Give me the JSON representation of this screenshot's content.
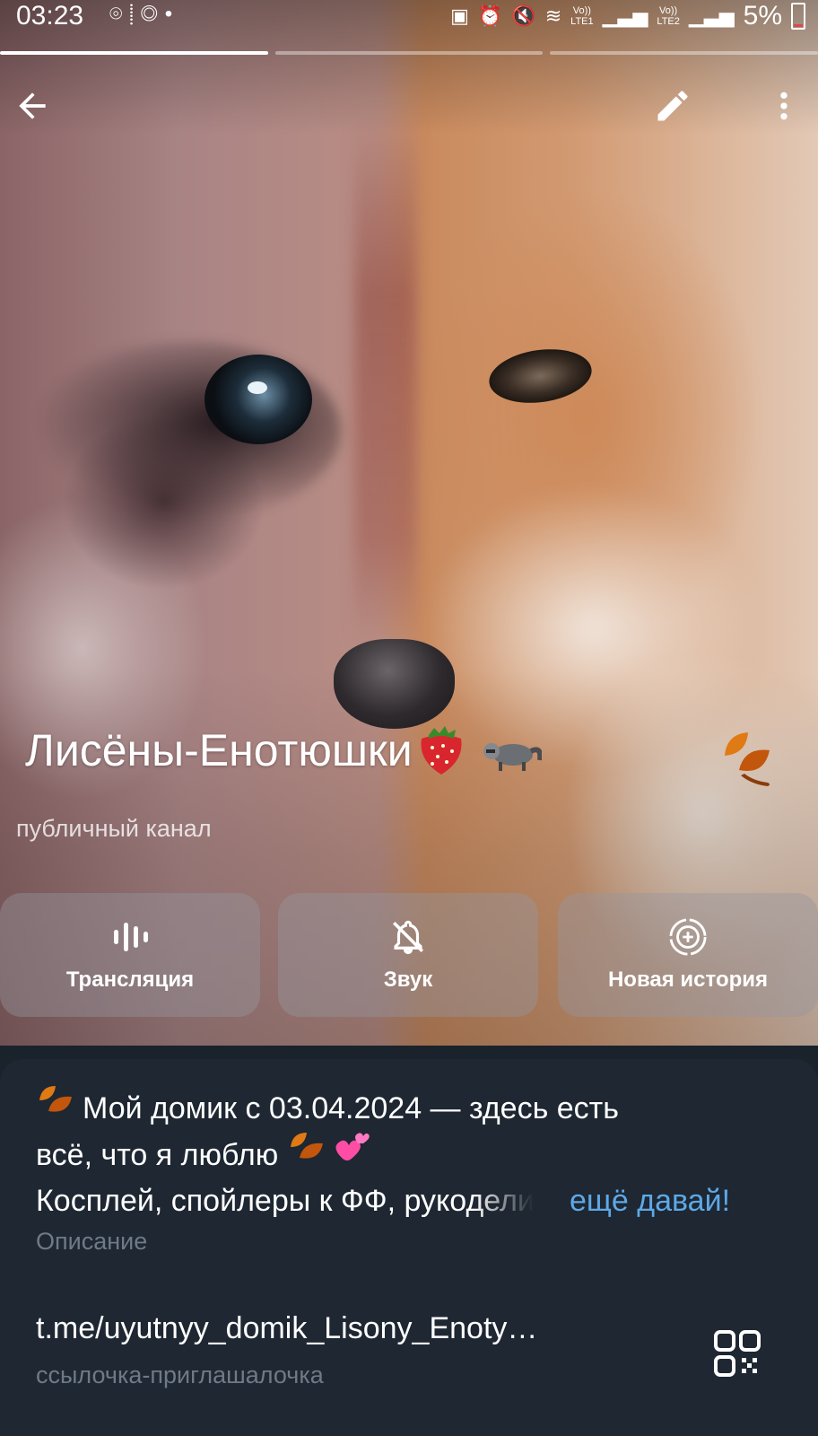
{
  "status_bar": {
    "time": "03:23",
    "left_icons": [
      "tracking-icon",
      "steps-icon",
      "nfc-icon",
      "dot-icon"
    ],
    "sim1": "LTE1",
    "sim2": "LTE2",
    "volte": "Vo))",
    "battery_percent": "5%"
  },
  "story_progress": {
    "segments": 3,
    "active_index": 0
  },
  "toolbar": {
    "back_icon": "arrow-left-icon",
    "edit_icon": "pencil-icon",
    "more_icon": "more-vertical-icon"
  },
  "channel": {
    "title_prefix": "’",
    "title": "Лисёны-Енотюшки",
    "title_emojis": [
      "🍓",
      "🦝",
      "🍂"
    ],
    "subtitle": "публичный канал"
  },
  "actions": [
    {
      "label": "Трансляция",
      "icon": "live-stream-icon"
    },
    {
      "label": "Звук",
      "icon": "bell-muted-icon"
    },
    {
      "label": "Новая история",
      "icon": "story-add-icon"
    }
  ],
  "info": {
    "description_line1": "Мой домик с 03.04.2024 — здесь есть",
    "description_line2": "всё, что я люблю",
    "description_line3": "Косплей, спойлеры к ФФ, рукоделие",
    "description_emojis": [
      "🍂",
      "🍂",
      "💕"
    ],
    "more_link": "ещё давай!",
    "description_caption": "Описание",
    "link": "t.me/uyutnyy_domik_Lisony_Enoty…",
    "link_caption": "ссылочка-приглашалочка",
    "qr_icon": "qr-code-icon"
  },
  "colors": {
    "accent_link": "#5ea8e6",
    "card_background": "#1e2732",
    "caption_gray": "#6f7a86"
  }
}
